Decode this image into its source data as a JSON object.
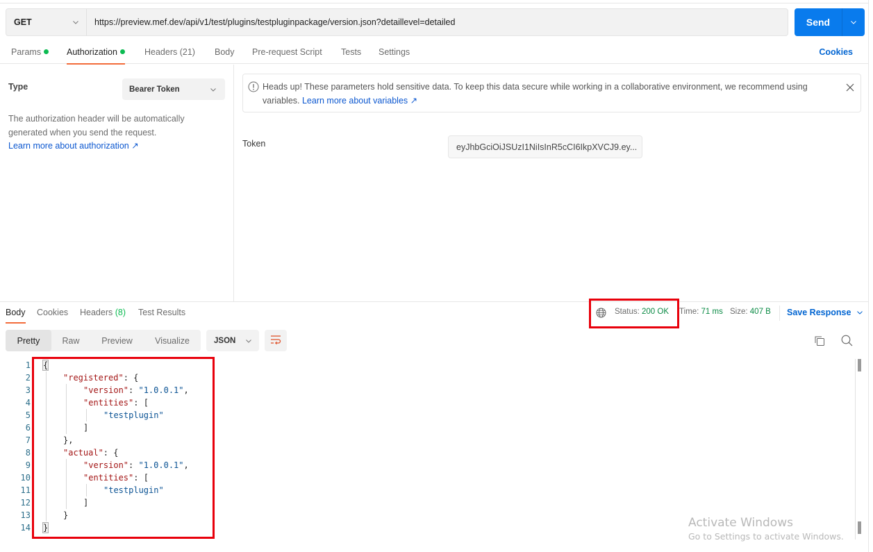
{
  "request": {
    "method": "GET",
    "url": "https://preview.mef.dev/api/v1/test/plugins/testpluginpackage/version.json?detaillevel=detailed",
    "send_label": "Send"
  },
  "request_tabs": [
    {
      "label": "Params",
      "dot": true
    },
    {
      "label": "Authorization",
      "dot": true,
      "active": true
    },
    {
      "label": "Headers",
      "count": "(21)"
    },
    {
      "label": "Body"
    },
    {
      "label": "Pre-request Script"
    },
    {
      "label": "Tests"
    },
    {
      "label": "Settings"
    }
  ],
  "cookies_label": "Cookies",
  "auth": {
    "type_label": "Type",
    "type_value": "Bearer Token",
    "description": "The authorization header will be automatically generated when you send the request.",
    "learn_more": "Learn more about authorization ↗",
    "heads_up_text": "Heads up! These parameters hold sensitive data. To keep this data secure while working in a collaborative environment, we recommend using variables.",
    "heads_up_link": "Learn more about variables ↗",
    "token_label": "Token",
    "token_value": "eyJhbGciOiJSUzI1NiIsInR5cCI6IkpXVCJ9.ey..."
  },
  "response_tabs": [
    {
      "label": "Body",
      "active": true
    },
    {
      "label": "Cookies"
    },
    {
      "label": "Headers",
      "count": "(8)"
    },
    {
      "label": "Test Results"
    }
  ],
  "status": {
    "status_label": "Status:",
    "status_value": "200 OK",
    "time_label": "Time:",
    "time_value": "71 ms",
    "size_label": "Size:",
    "size_value": "407 B",
    "save_response": "Save Response"
  },
  "view_modes": [
    "Pretty",
    "Raw",
    "Preview",
    "Visualize"
  ],
  "active_view": "Pretty",
  "format": "JSON",
  "code_lines": [
    {
      "n": "1",
      "indent": 0,
      "parts": [
        [
          "punct-box",
          "{"
        ]
      ]
    },
    {
      "n": "2",
      "indent": 1,
      "parts": [
        [
          "key",
          "\"registered\""
        ],
        [
          "punct",
          ": {"
        ]
      ]
    },
    {
      "n": "3",
      "indent": 2,
      "parts": [
        [
          "key",
          "\"version\""
        ],
        [
          "punct",
          ": "
        ],
        [
          "str",
          "\"1.0.0.1\""
        ],
        [
          "punct",
          ","
        ]
      ]
    },
    {
      "n": "4",
      "indent": 2,
      "parts": [
        [
          "key",
          "\"entities\""
        ],
        [
          "punct",
          ": ["
        ]
      ]
    },
    {
      "n": "5",
      "indent": 3,
      "parts": [
        [
          "str",
          "\"testplugin\""
        ]
      ]
    },
    {
      "n": "6",
      "indent": 2,
      "parts": [
        [
          "punct",
          "]"
        ]
      ]
    },
    {
      "n": "7",
      "indent": 1,
      "parts": [
        [
          "punct",
          "},"
        ]
      ]
    },
    {
      "n": "8",
      "indent": 1,
      "parts": [
        [
          "key",
          "\"actual\""
        ],
        [
          "punct",
          ": {"
        ]
      ]
    },
    {
      "n": "9",
      "indent": 2,
      "parts": [
        [
          "key",
          "\"version\""
        ],
        [
          "punct",
          ": "
        ],
        [
          "str",
          "\"1.0.0.1\""
        ],
        [
          "punct",
          ","
        ]
      ]
    },
    {
      "n": "10",
      "indent": 2,
      "parts": [
        [
          "key",
          "\"entities\""
        ],
        [
          "punct",
          ": ["
        ]
      ]
    },
    {
      "n": "11",
      "indent": 3,
      "parts": [
        [
          "str",
          "\"testplugin\""
        ]
      ]
    },
    {
      "n": "12",
      "indent": 2,
      "parts": [
        [
          "punct",
          "]"
        ]
      ]
    },
    {
      "n": "13",
      "indent": 1,
      "parts": [
        [
          "punct",
          "}"
        ]
      ]
    },
    {
      "n": "14",
      "indent": 0,
      "parts": [
        [
          "punct-box",
          "}"
        ]
      ]
    }
  ],
  "watermark": {
    "title": "Activate Windows",
    "subtitle": "Go to Settings to activate Windows."
  },
  "colors": {
    "accent": "#097bed",
    "tab_underline": "#f26b3a",
    "status_green": "#0cbb52",
    "highlight_red": "#e8000b",
    "link_blue": "#0265d2"
  }
}
